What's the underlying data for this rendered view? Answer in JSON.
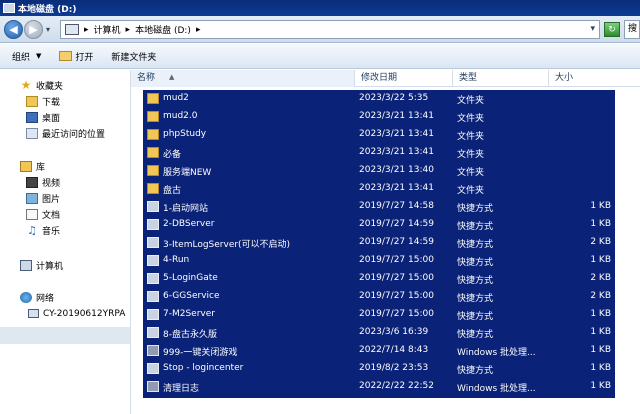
{
  "window": {
    "title": "本地磁盘 (D:)"
  },
  "address": {
    "crumb_computer": "计算机",
    "crumb_drive": "本地磁盘 (D:)",
    "search_placeholder": "搜"
  },
  "toolbar": {
    "organize": "组织",
    "open": "打开",
    "new_folder": "新建文件夹"
  },
  "nav": {
    "favorites": "收藏夹",
    "downloads": "下载",
    "desktop": "桌面",
    "recent": "最近访问的位置",
    "libraries": "库",
    "videos": "视频",
    "pictures": "图片",
    "documents": "文档",
    "music": "音乐",
    "computer": "计算机",
    "network": "网络",
    "network_pc": "CY-20190612YRPA"
  },
  "columns": {
    "name": "名称",
    "date": "修改日期",
    "type": "类型",
    "size": "大小"
  },
  "files": [
    {
      "name": "mud2",
      "date": "2023/3/22 5:35",
      "type": "文件夹",
      "size": "",
      "icon": "folder-icon"
    },
    {
      "name": "mud2.0",
      "date": "2023/3/21 13:41",
      "type": "文件夹",
      "size": "",
      "icon": "folder-icon"
    },
    {
      "name": "phpStudy",
      "date": "2023/3/21 13:41",
      "type": "文件夹",
      "size": "",
      "icon": "folder-icon"
    },
    {
      "name": "必备",
      "date": "2023/3/21 13:41",
      "type": "文件夹",
      "size": "",
      "icon": "folder-icon"
    },
    {
      "name": "服务端NEW",
      "date": "2023/3/21 13:40",
      "type": "文件夹",
      "size": "",
      "icon": "folder-icon"
    },
    {
      "name": "盘古",
      "date": "2023/3/21 13:41",
      "type": "文件夹",
      "size": "",
      "icon": "folder-icon"
    },
    {
      "name": "1-启动网站",
      "date": "2019/7/27 14:58",
      "type": "快捷方式",
      "size": "1 KB",
      "icon": "shortcut-icon"
    },
    {
      "name": "2-DBServer",
      "date": "2019/7/27 14:59",
      "type": "快捷方式",
      "size": "1 KB",
      "icon": "shortcut-icon"
    },
    {
      "name": "3-ItemLogServer(可以不启动)",
      "date": "2019/7/27 14:59",
      "type": "快捷方式",
      "size": "2 KB",
      "icon": "shortcut-icon"
    },
    {
      "name": "4-Run",
      "date": "2019/7/27 15:00",
      "type": "快捷方式",
      "size": "1 KB",
      "icon": "shortcut-icon"
    },
    {
      "name": "5-LoginGate",
      "date": "2019/7/27 15:00",
      "type": "快捷方式",
      "size": "2 KB",
      "icon": "shortcut-icon"
    },
    {
      "name": "6-GGService",
      "date": "2019/7/27 15:00",
      "type": "快捷方式",
      "size": "2 KB",
      "icon": "shortcut-icon"
    },
    {
      "name": "7-M2Server",
      "date": "2019/7/27 15:00",
      "type": "快捷方式",
      "size": "1 KB",
      "icon": "shortcut-icon"
    },
    {
      "name": "8-盘古永久版",
      "date": "2023/3/6 16:39",
      "type": "快捷方式",
      "size": "1 KB",
      "icon": "shortcut-icon"
    },
    {
      "name": "999-一键关闭游戏",
      "date": "2022/7/14 8:43",
      "type": "Windows 批处理...",
      "size": "1 KB",
      "icon": "batch-file-icon"
    },
    {
      "name": "Stop - logincenter",
      "date": "2019/8/2 23:53",
      "type": "快捷方式",
      "size": "1 KB",
      "icon": "shortcut-icon"
    },
    {
      "name": "清理日志",
      "date": "2022/2/22 22:52",
      "type": "Windows 批处理...",
      "size": "1 KB",
      "icon": "batch-file-icon"
    }
  ],
  "colors": {
    "selection": "#0a2277",
    "title_bar": "#0c3a95"
  }
}
